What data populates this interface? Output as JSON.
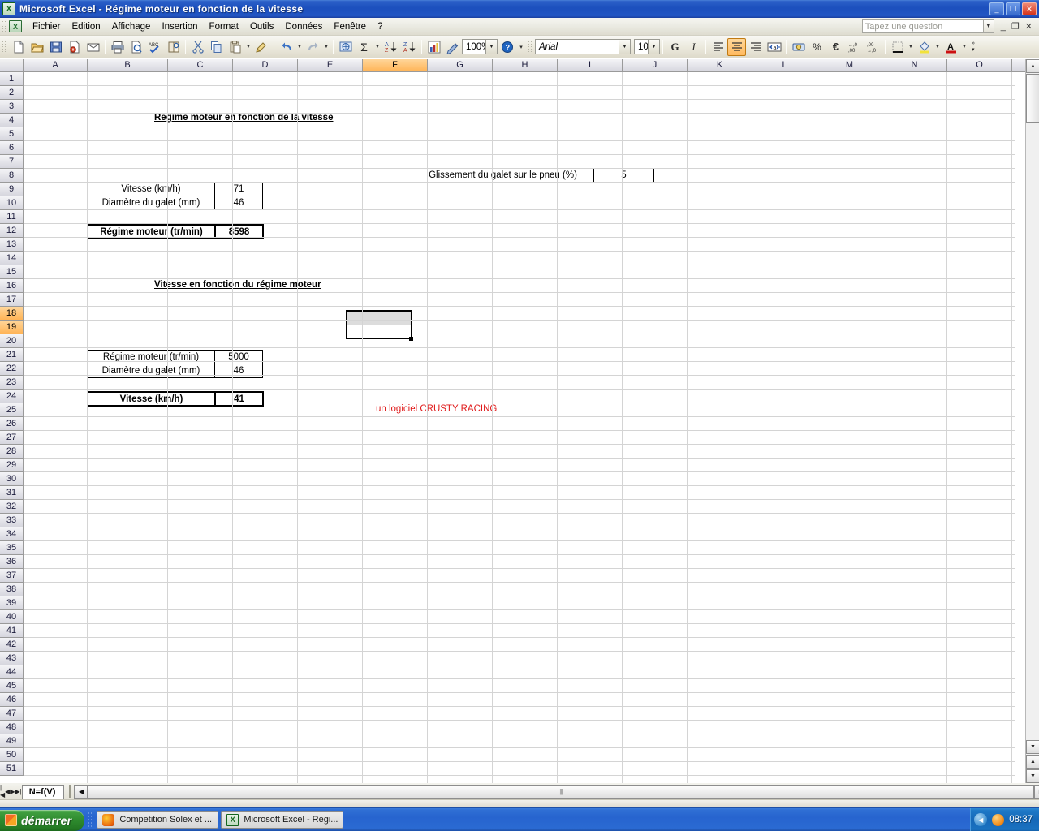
{
  "window": {
    "title": "Microsoft Excel - Régime moteur en fonction de la vitesse",
    "app_icon": "excel-icon",
    "minimize": "_",
    "restore": "❐",
    "close": "✕"
  },
  "menu": {
    "items": [
      {
        "label": "Fichier",
        "accel": "F"
      },
      {
        "label": "Edition",
        "accel": "E"
      },
      {
        "label": "Affichage",
        "accel": "A"
      },
      {
        "label": "Insertion",
        "accel": "I"
      },
      {
        "label": "Format",
        "accel": "t"
      },
      {
        "label": "Outils",
        "accel": "O"
      },
      {
        "label": "Données",
        "accel": "D"
      },
      {
        "label": "Fenêtre",
        "accel": "ê"
      },
      {
        "label": "?",
        "accel": ""
      }
    ],
    "ask_placeholder": "Tapez une question",
    "doc_minimize": "_",
    "doc_restore": "❐",
    "doc_close": "✕"
  },
  "toolbar": {
    "buttons": [
      {
        "name": "new-button",
        "glyph": "🗋"
      },
      {
        "name": "open-button",
        "glyph": "📂"
      },
      {
        "name": "save-button",
        "glyph": "💾"
      },
      {
        "name": "permission-button",
        "glyph": "🔒"
      },
      {
        "name": "email-button",
        "glyph": "✉"
      },
      {
        "name": "print-button",
        "glyph": "🖨"
      },
      {
        "name": "print-preview-button",
        "glyph": "🔍"
      },
      {
        "name": "spelling-button",
        "glyph": "ABC"
      },
      {
        "name": "research-button",
        "glyph": "📖"
      },
      {
        "name": "cut-button",
        "glyph": "✂"
      },
      {
        "name": "copy-button",
        "glyph": "⧉"
      },
      {
        "name": "paste-button",
        "glyph": "📋"
      },
      {
        "name": "format-painter-button",
        "glyph": "🖌"
      },
      {
        "name": "undo-button",
        "glyph": "↶"
      },
      {
        "name": "redo-button",
        "glyph": "↷"
      },
      {
        "name": "hyperlink-button",
        "glyph": "🌐"
      },
      {
        "name": "autosum-button",
        "glyph": "Σ"
      },
      {
        "name": "sort-ascending-button",
        "glyph": "A↓"
      },
      {
        "name": "sort-descending-button",
        "glyph": "Z↓"
      },
      {
        "name": "chart-wizard-button",
        "glyph": "📊"
      },
      {
        "name": "drawing-button",
        "glyph": "✎"
      }
    ],
    "zoom_value": "100%",
    "help_button": "?",
    "font_name": "Arial",
    "font_size": "10",
    "bold_label": "G",
    "italic_label": "I",
    "align_left": "≡",
    "align_center": "≡",
    "align_right": "≡",
    "merge_center": "↔a↔",
    "currency_label": "€",
    "percent_label": "%",
    "comma_label": "000",
    "increase_decimal": "+,0",
    "decrease_decimal": "-,0",
    "borders_label": "▦",
    "fill_color_label": "A",
    "font_color_label": "A"
  },
  "grid": {
    "columns": [
      "A",
      "B",
      "C",
      "D",
      "E",
      "F",
      "G",
      "H",
      "I",
      "J",
      "K",
      "L",
      "M",
      "N",
      "O"
    ],
    "active_column": "F",
    "rows": [
      1,
      2,
      3,
      4,
      5,
      6,
      7,
      8,
      9,
      10,
      11,
      12,
      13,
      14,
      15,
      16,
      17,
      18,
      19,
      20,
      21,
      22,
      23,
      24,
      25,
      26,
      27,
      28,
      29,
      30,
      31,
      32,
      33,
      34,
      35,
      36,
      37,
      38,
      39,
      40,
      41,
      42,
      43,
      44,
      45,
      46,
      47,
      48,
      49,
      50,
      51
    ],
    "active_rows": [
      18,
      19
    ],
    "selection_range": "F18:F19"
  },
  "sheet": {
    "section1": {
      "title": "Régime moteur en fonction de la vitesse",
      "inputs": [
        {
          "label": "Vitesse (km/h)",
          "value": "71"
        },
        {
          "label": "Diamètre du galet (mm)",
          "value": "46"
        }
      ],
      "result": {
        "label": "Régime moteur (tr/min)",
        "value": "8598"
      }
    },
    "slip": {
      "label": "Glissement du galet sur le pneu (%)",
      "value": "5"
    },
    "section2": {
      "title": "Vitesse en fonction du régime moteur",
      "inputs": [
        {
          "label": "Régime moteur (tr/min)",
          "value": "5000"
        },
        {
          "label": "Diamètre du galet (mm)",
          "value": "46"
        }
      ],
      "result": {
        "label": "Vitesse (km/h)",
        "value": "41"
      }
    },
    "footer_note": "un logiciel CRUSTY RACING",
    "footer_note_color": "#e01b1b"
  },
  "tabbar": {
    "nav_first": "|◀",
    "nav_prev": "◀",
    "nav_next": "▶",
    "nav_last": "▶|",
    "sheets": [
      {
        "label": "N=f(V)",
        "active": true
      }
    ],
    "hscroll_left": "◀",
    "hscroll_right": "▶"
  },
  "taskbar": {
    "start_label": "démarrer",
    "items": [
      {
        "label": "Competition Solex et ...",
        "icon": "firefox-icon"
      },
      {
        "label": "Microsoft Excel - Régi...",
        "icon": "excel-icon"
      }
    ],
    "tray": {
      "show_hidden": "◀",
      "clock": "08:37"
    }
  }
}
